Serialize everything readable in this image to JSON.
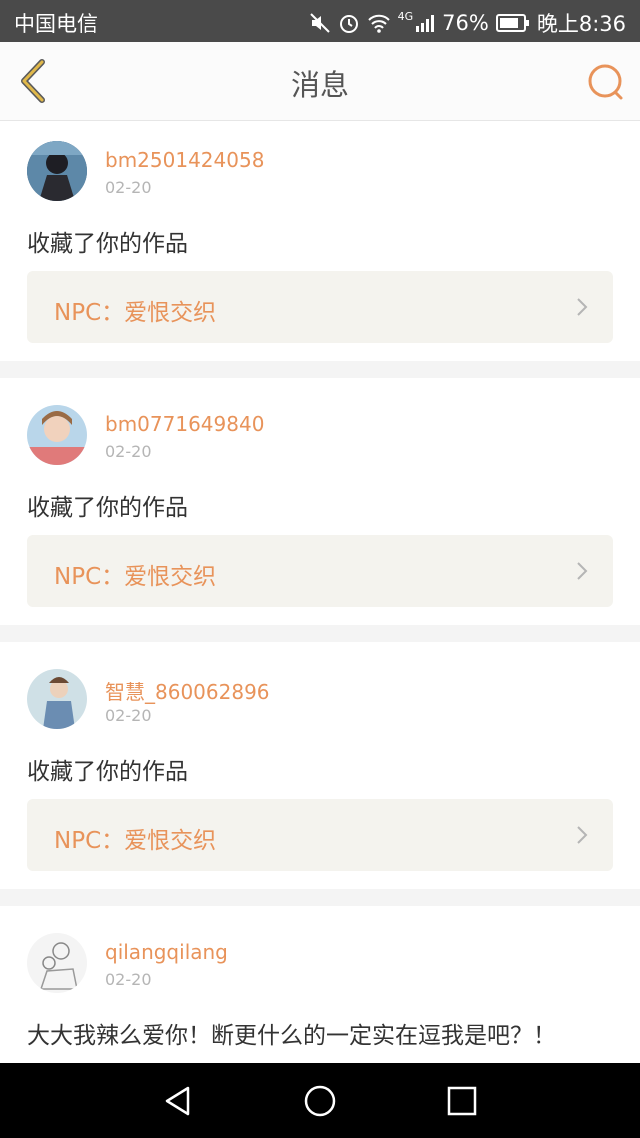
{
  "status_bar": {
    "carrier": "中国电信",
    "network": "4G",
    "battery": "76%",
    "time": "晚上8:36"
  },
  "nav": {
    "title": "消息"
  },
  "messages": [
    {
      "username": "bm2501424058",
      "date": "02-20",
      "text": "收藏了你的作品",
      "work": "NPC：爱恨交织"
    },
    {
      "username": "bm0771649840",
      "date": "02-20",
      "text": "收藏了你的作品",
      "work": "NPC：爱恨交织"
    },
    {
      "username": "智慧_860062896",
      "date": "02-20",
      "text": "收藏了你的作品",
      "work": "NPC：爱恨交织"
    },
    {
      "username": "qilangqilang",
      "date": "02-20",
      "text": "大大我辣么爱你！断更什么的一定实在逗我是吧？！"
    }
  ],
  "colors": {
    "accent": "#e8935a",
    "back_arrow": "#e0b84a",
    "status_bar_bg": "#4a4a4a",
    "work_bg": "#f4f3ee"
  }
}
